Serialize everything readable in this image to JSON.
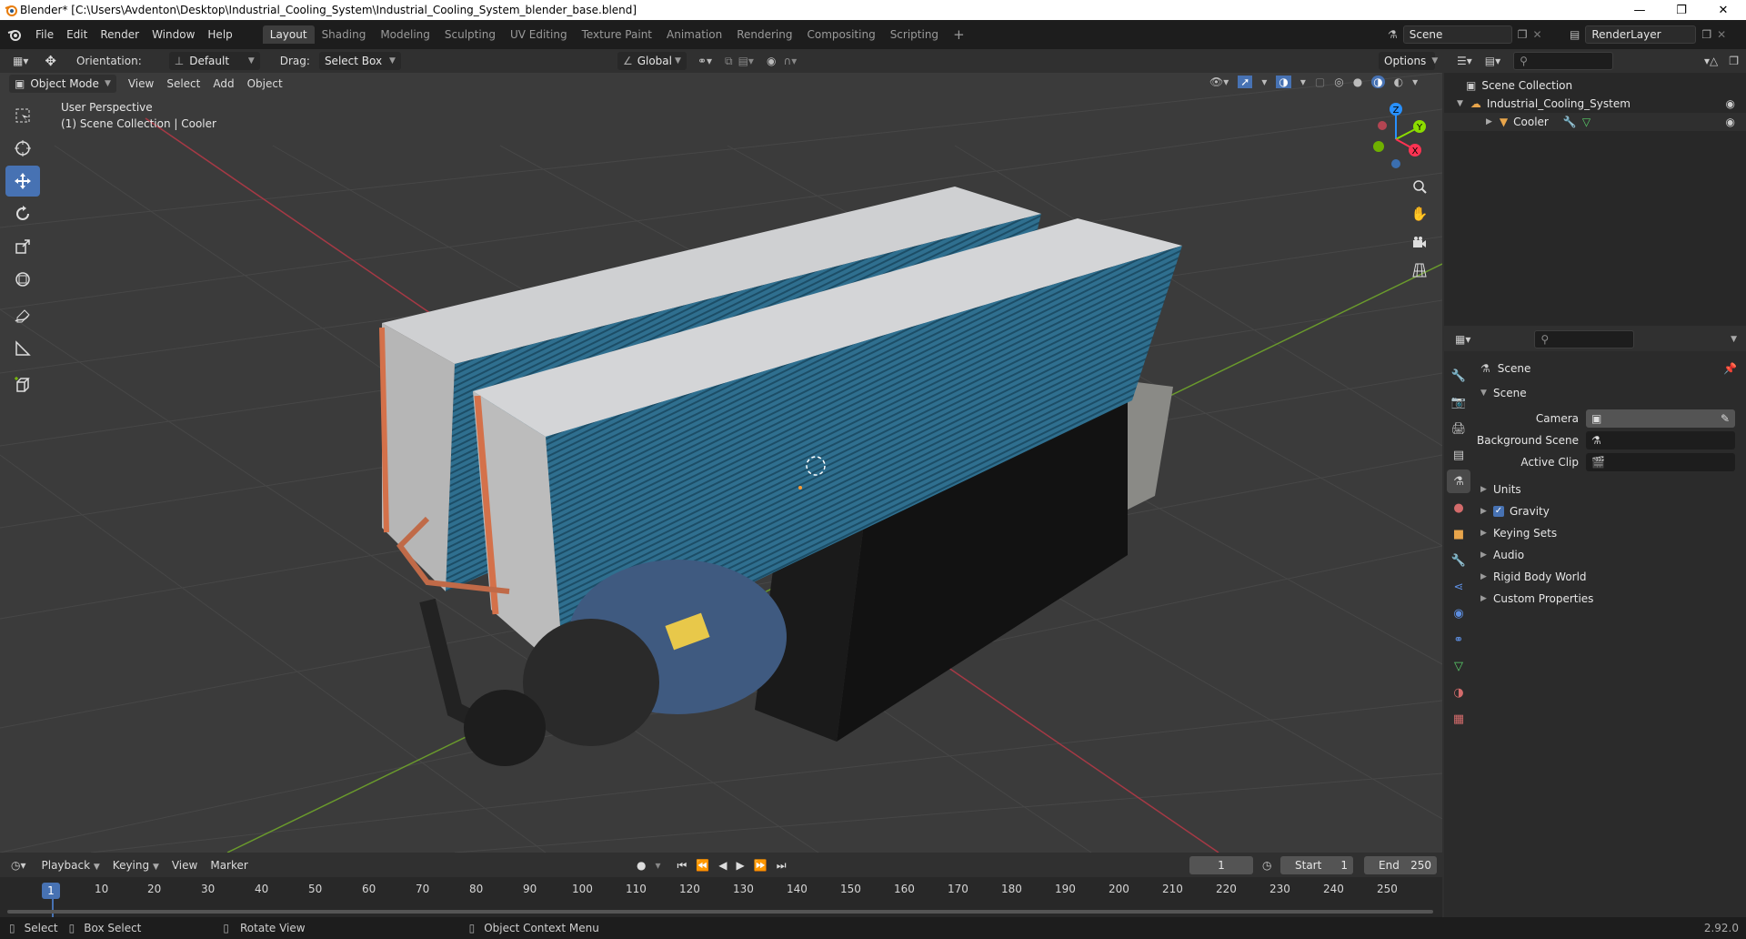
{
  "window": {
    "title": "Blender* [C:\\Users\\Avdenton\\Desktop\\Industrial_Cooling_System\\Industrial_Cooling_System_blender_base.blend]"
  },
  "menu": [
    "File",
    "Edit",
    "Render",
    "Window",
    "Help"
  ],
  "workspaces": [
    "Layout",
    "Shading",
    "Modeling",
    "Sculpting",
    "UV Editing",
    "Texture Paint",
    "Animation",
    "Rendering",
    "Compositing",
    "Scripting"
  ],
  "active_workspace": "Layout",
  "scene_field": "Scene",
  "render_layer": "RenderLayer",
  "header": {
    "orientation_label": "Orientation:",
    "orientation_value": "Default",
    "drag_label": "Drag:",
    "drag_value": "Select Box",
    "transform_space": "Global",
    "options": "Options"
  },
  "viewport_header": {
    "mode": "Object Mode",
    "menus": [
      "View",
      "Select",
      "Add",
      "Object"
    ]
  },
  "viewport_overlay": {
    "perspective": "User Perspective",
    "collection": "(1) Scene Collection | Cooler"
  },
  "gizmo": {
    "z": "Z",
    "y": "Y",
    "x": "X"
  },
  "outliner": {
    "root": "Scene Collection",
    "collection": "Industrial_Cooling_System",
    "object": "Cooler"
  },
  "properties": {
    "header": "Scene",
    "section": "Scene",
    "camera_label": "Camera",
    "background_label": "Background Scene",
    "clip_label": "Active Clip",
    "panels": [
      "Units",
      "Gravity",
      "Keying Sets",
      "Audio",
      "Rigid Body World",
      "Custom Properties"
    ],
    "gravity_checked": true
  },
  "timeline": {
    "menus": [
      "Playback",
      "Keying",
      "View",
      "Marker"
    ],
    "current_frame": "1",
    "start_label": "Start",
    "start": "1",
    "end_label": "End",
    "end": "250",
    "ticks": [
      "10",
      "20",
      "30",
      "40",
      "50",
      "60",
      "70",
      "80",
      "90",
      "100",
      "110",
      "120",
      "130",
      "140",
      "150",
      "160",
      "170",
      "180",
      "190",
      "200",
      "210",
      "220",
      "230",
      "240",
      "250"
    ],
    "cursor_frame": "1"
  },
  "statusbar": {
    "select": "Select",
    "box_select": "Box Select",
    "rotate": "Rotate View",
    "context_menu": "Object Context Menu",
    "version": "2.92.0"
  },
  "colors": {
    "accent": "#4772b3",
    "x_axis": "#ff3352",
    "y_axis": "#8bdc00",
    "z_axis": "#2890ff",
    "viewport_bg": "#3b3b3b",
    "panel_bg": "#2b2b2b"
  }
}
